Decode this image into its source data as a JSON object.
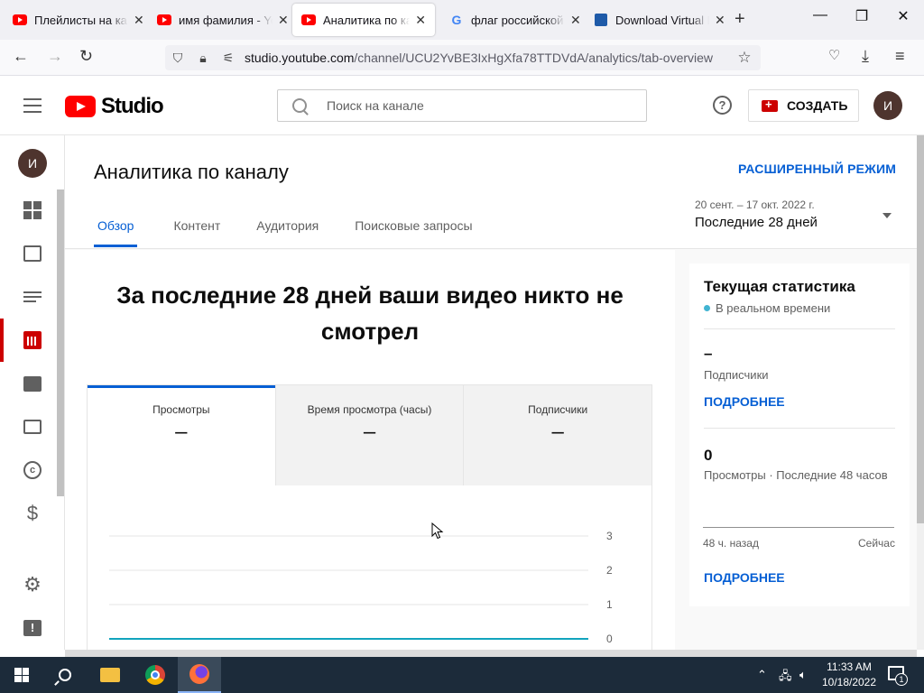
{
  "browser": {
    "tabs": [
      {
        "title": "Плейлисты на канале",
        "icon": "youtube-icon"
      },
      {
        "title": "имя фамилия - YouTube",
        "icon": "youtube-icon"
      },
      {
        "title": "Аналитика по каналу",
        "icon": "youtube-icon"
      },
      {
        "title": "флаг российской империи",
        "icon": "google-icon"
      },
      {
        "title": "Download Virtual DJ",
        "icon": "virtualdj-icon"
      }
    ],
    "url_domain": "studio.youtube.com",
    "url_rest": "/channel/UCU2YvBE3IxHgXfa78TTDVdA/analytics/tab-overview"
  },
  "header": {
    "logo_text": "Studio",
    "search_placeholder": "Поиск на канале",
    "create_label": "СОЗДАТЬ",
    "avatar_letter": "И"
  },
  "sidebar": {
    "avatar_letter": "И",
    "items": [
      {
        "name": "dashboard-icon"
      },
      {
        "name": "content-icon"
      },
      {
        "name": "playlists-icon"
      },
      {
        "name": "analytics-icon",
        "active": true
      },
      {
        "name": "comments-icon"
      },
      {
        "name": "subtitles-icon"
      },
      {
        "name": "copyright-icon"
      },
      {
        "name": "monetization-icon"
      },
      {
        "name": "settings-icon"
      },
      {
        "name": "feedback-icon"
      }
    ]
  },
  "page": {
    "title": "Аналитика по каналу",
    "advanced_mode": "РАСШИРЕННЫЙ РЕЖИМ",
    "tabs": [
      "Обзор",
      "Контент",
      "Аудитория",
      "Поисковые запросы"
    ],
    "active_tab": "Обзор",
    "date_range": "20 сент. – 17 окт. 2022 г.",
    "date_label": "Последние 28 дней",
    "headline": "За последние 28 дней ваши видео никто не смотрел",
    "metrics": [
      {
        "label": "Просмотры",
        "value": "–"
      },
      {
        "label": "Время просмотра (часы)",
        "value": "–"
      },
      {
        "label": "Подписчики",
        "value": "–"
      }
    ]
  },
  "realtime": {
    "title": "Текущая статистика",
    "live": "В реальном времени",
    "subscribers_value": "–",
    "subscribers_label": "Подписчики",
    "details_link": "ПОДРОБНЕЕ",
    "views_value": "0",
    "views_label": "Просмотры · Последние 48 часов",
    "axis_left": "48 ч. назад",
    "axis_right": "Сейчас",
    "details_link2": "ПОДРОБНЕЕ"
  },
  "chart_data": {
    "type": "line",
    "y_ticks": [
      "3",
      "2",
      "1",
      "0"
    ],
    "ylim": [
      0,
      3
    ],
    "series": [
      {
        "values": [
          0,
          0
        ]
      }
    ],
    "color": "#12a4bd"
  },
  "taskbar": {
    "time": "11:33 AM",
    "date": "10/18/2022",
    "notifications": "1"
  }
}
